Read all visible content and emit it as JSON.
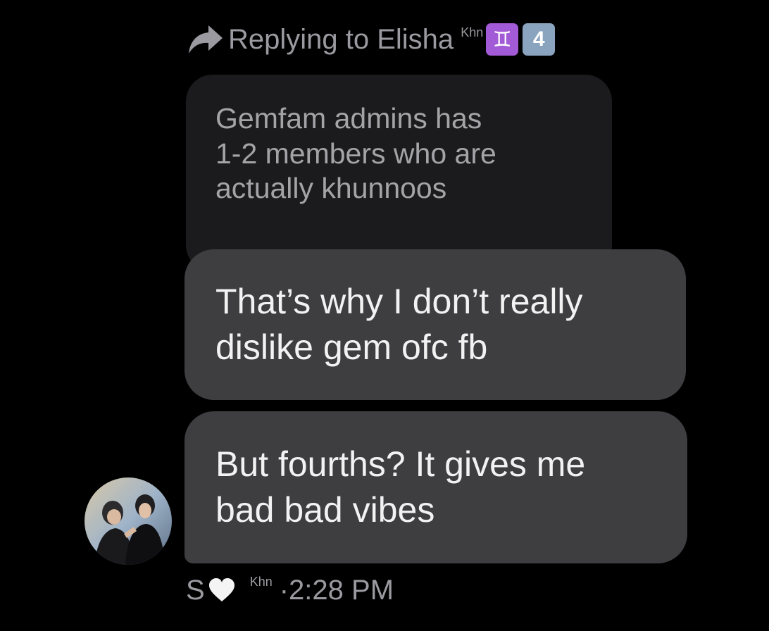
{
  "reply": {
    "label": "Replying to Elisha",
    "superscript": "Khn",
    "badge_gemini": "♊",
    "badge_number": "4",
    "icon": "reply-arrow-icon"
  },
  "quoted_message": {
    "lines": [
      "Gemfam admins has",
      "1-2 members who are",
      "actually khunnoos"
    ]
  },
  "messages": [
    {
      "lines": [
        "That’s why I don’t really",
        "dislike gem ofc fb"
      ]
    },
    {
      "lines": [
        "But fourths? It gives me",
        "bad bad vibes"
      ]
    }
  ],
  "sender": {
    "name": "S",
    "superscript": "Khn",
    "separator": "·",
    "time": "2:28 PM",
    "heart_icon": "white-heart-icon",
    "avatar": "avatar-photo"
  },
  "colors": {
    "background": "#000000",
    "quoted_bubble": "#1b1b1e",
    "message_bubble": "#3e3e41",
    "muted_text": "#9a9aa0"
  }
}
